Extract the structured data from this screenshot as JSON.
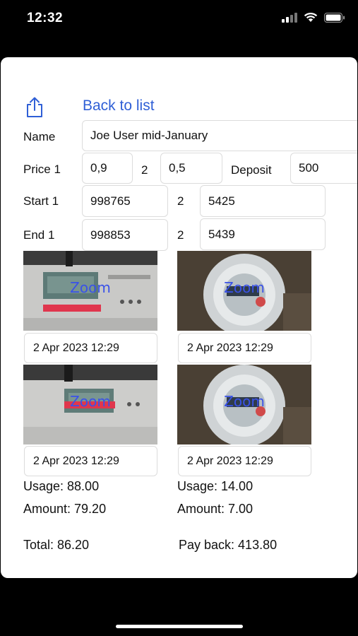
{
  "status": {
    "time": "12:32"
  },
  "header": {
    "back_label": "Back to list"
  },
  "form": {
    "name_label": "Name",
    "name_value": "Joe User mid-January",
    "price_label": "Price 1",
    "price1_value": "0,9",
    "price2_label": "2",
    "price2_value": "0,5",
    "deposit_label": "Deposit",
    "deposit_value": "500",
    "start_label": "Start 1",
    "start1_value": "998765",
    "start2_label": "2",
    "start2_value": "5425",
    "end_label": "End 1",
    "end1_value": "998853",
    "end2_label": "2",
    "end2_value": "5439"
  },
  "photos": [
    {
      "zoom_label": "Zoom",
      "date": "2 Apr 2023 12:29"
    },
    {
      "zoom_label": "Zoom",
      "date": "2 Apr 2023 12:29"
    },
    {
      "zoom_label": "Zoom",
      "date": "2 Apr 2023 12:29"
    },
    {
      "zoom_label": "Zoom",
      "date": "2 Apr 2023 12:29"
    }
  ],
  "summary": {
    "usage1": "Usage: 88.00",
    "usage2": "Usage: 14.00",
    "amount1": "Amount: 79.20",
    "amount2": "Amount: 7.00",
    "total": "Total: 86.20",
    "payback": "Pay back: 413.80"
  },
  "colors": {
    "accent": "#2f5fd6",
    "zoom_text": "#3a52e8"
  }
}
